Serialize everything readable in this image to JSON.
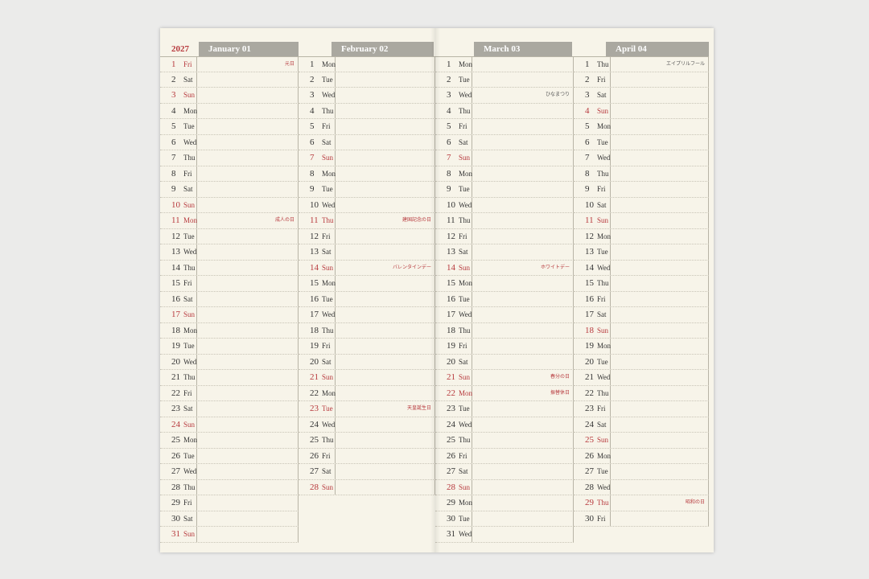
{
  "year": "2027",
  "months": [
    {
      "title": "January 01",
      "days": [
        {
          "d": "1",
          "w": "Fri",
          "red": true,
          "h": "元日"
        },
        {
          "d": "2",
          "w": "Sat"
        },
        {
          "d": "3",
          "w": "Sun",
          "red": true
        },
        {
          "d": "4",
          "w": "Mon"
        },
        {
          "d": "5",
          "w": "Tue"
        },
        {
          "d": "6",
          "w": "Wed"
        },
        {
          "d": "7",
          "w": "Thu"
        },
        {
          "d": "8",
          "w": "Fri"
        },
        {
          "d": "9",
          "w": "Sat"
        },
        {
          "d": "10",
          "w": "Sun",
          "red": true
        },
        {
          "d": "11",
          "w": "Mon",
          "red": true,
          "h": "成人の日"
        },
        {
          "d": "12",
          "w": "Tue"
        },
        {
          "d": "13",
          "w": "Wed"
        },
        {
          "d": "14",
          "w": "Thu"
        },
        {
          "d": "15",
          "w": "Fri"
        },
        {
          "d": "16",
          "w": "Sat"
        },
        {
          "d": "17",
          "w": "Sun",
          "red": true
        },
        {
          "d": "18",
          "w": "Mon"
        },
        {
          "d": "19",
          "w": "Tue"
        },
        {
          "d": "20",
          "w": "Wed"
        },
        {
          "d": "21",
          "w": "Thu"
        },
        {
          "d": "22",
          "w": "Fri"
        },
        {
          "d": "23",
          "w": "Sat"
        },
        {
          "d": "24",
          "w": "Sun",
          "red": true
        },
        {
          "d": "25",
          "w": "Mon"
        },
        {
          "d": "26",
          "w": "Tue"
        },
        {
          "d": "27",
          "w": "Wed"
        },
        {
          "d": "28",
          "w": "Thu"
        },
        {
          "d": "29",
          "w": "Fri"
        },
        {
          "d": "30",
          "w": "Sat"
        },
        {
          "d": "31",
          "w": "Sun",
          "red": true
        }
      ]
    },
    {
      "title": "February 02",
      "days": [
        {
          "d": "1",
          "w": "Mon"
        },
        {
          "d": "2",
          "w": "Tue"
        },
        {
          "d": "3",
          "w": "Wed"
        },
        {
          "d": "4",
          "w": "Thu"
        },
        {
          "d": "5",
          "w": "Fri"
        },
        {
          "d": "6",
          "w": "Sat"
        },
        {
          "d": "7",
          "w": "Sun",
          "red": true
        },
        {
          "d": "8",
          "w": "Mon"
        },
        {
          "d": "9",
          "w": "Tue"
        },
        {
          "d": "10",
          "w": "Wed"
        },
        {
          "d": "11",
          "w": "Thu",
          "red": true,
          "h": "建国記念の日"
        },
        {
          "d": "12",
          "w": "Fri"
        },
        {
          "d": "13",
          "w": "Sat"
        },
        {
          "d": "14",
          "w": "Sun",
          "red": true,
          "h": "バレンタインデー"
        },
        {
          "d": "15",
          "w": "Mon"
        },
        {
          "d": "16",
          "w": "Tue"
        },
        {
          "d": "17",
          "w": "Wed"
        },
        {
          "d": "18",
          "w": "Thu"
        },
        {
          "d": "19",
          "w": "Fri"
        },
        {
          "d": "20",
          "w": "Sat"
        },
        {
          "d": "21",
          "w": "Sun",
          "red": true
        },
        {
          "d": "22",
          "w": "Mon"
        },
        {
          "d": "23",
          "w": "Tue",
          "red": true,
          "h": "天皇誕生日"
        },
        {
          "d": "24",
          "w": "Wed"
        },
        {
          "d": "25",
          "w": "Thu"
        },
        {
          "d": "26",
          "w": "Fri"
        },
        {
          "d": "27",
          "w": "Sat"
        },
        {
          "d": "28",
          "w": "Sun",
          "red": true
        }
      ]
    },
    {
      "title": "March 03",
      "days": [
        {
          "d": "1",
          "w": "Mon"
        },
        {
          "d": "2",
          "w": "Tue"
        },
        {
          "d": "3",
          "w": "Wed",
          "h": "ひなまつり",
          "dark": true
        },
        {
          "d": "4",
          "w": "Thu"
        },
        {
          "d": "5",
          "w": "Fri"
        },
        {
          "d": "6",
          "w": "Sat"
        },
        {
          "d": "7",
          "w": "Sun",
          "red": true
        },
        {
          "d": "8",
          "w": "Mon"
        },
        {
          "d": "9",
          "w": "Tue"
        },
        {
          "d": "10",
          "w": "Wed"
        },
        {
          "d": "11",
          "w": "Thu"
        },
        {
          "d": "12",
          "w": "Fri"
        },
        {
          "d": "13",
          "w": "Sat"
        },
        {
          "d": "14",
          "w": "Sun",
          "red": true,
          "h": "ホワイトデー"
        },
        {
          "d": "15",
          "w": "Mon"
        },
        {
          "d": "16",
          "w": "Tue"
        },
        {
          "d": "17",
          "w": "Wed"
        },
        {
          "d": "18",
          "w": "Thu"
        },
        {
          "d": "19",
          "w": "Fri"
        },
        {
          "d": "20",
          "w": "Sat"
        },
        {
          "d": "21",
          "w": "Sun",
          "red": true,
          "h": "春分の日"
        },
        {
          "d": "22",
          "w": "Mon",
          "red": true,
          "h": "振替休日"
        },
        {
          "d": "23",
          "w": "Tue"
        },
        {
          "d": "24",
          "w": "Wed"
        },
        {
          "d": "25",
          "w": "Thu"
        },
        {
          "d": "26",
          "w": "Fri"
        },
        {
          "d": "27",
          "w": "Sat"
        },
        {
          "d": "28",
          "w": "Sun",
          "red": true
        },
        {
          "d": "29",
          "w": "Mon"
        },
        {
          "d": "30",
          "w": "Tue"
        },
        {
          "d": "31",
          "w": "Wed"
        }
      ]
    },
    {
      "title": "April 04",
      "days": [
        {
          "d": "1",
          "w": "Thu",
          "h": "エイプリルフール",
          "dark": true
        },
        {
          "d": "2",
          "w": "Fri"
        },
        {
          "d": "3",
          "w": "Sat"
        },
        {
          "d": "4",
          "w": "Sun",
          "red": true
        },
        {
          "d": "5",
          "w": "Mon"
        },
        {
          "d": "6",
          "w": "Tue"
        },
        {
          "d": "7",
          "w": "Wed"
        },
        {
          "d": "8",
          "w": "Thu"
        },
        {
          "d": "9",
          "w": "Fri"
        },
        {
          "d": "10",
          "w": "Sat"
        },
        {
          "d": "11",
          "w": "Sun",
          "red": true
        },
        {
          "d": "12",
          "w": "Mon"
        },
        {
          "d": "13",
          "w": "Tue"
        },
        {
          "d": "14",
          "w": "Wed"
        },
        {
          "d": "15",
          "w": "Thu"
        },
        {
          "d": "16",
          "w": "Fri"
        },
        {
          "d": "17",
          "w": "Sat"
        },
        {
          "d": "18",
          "w": "Sun",
          "red": true
        },
        {
          "d": "19",
          "w": "Mon"
        },
        {
          "d": "20",
          "w": "Tue"
        },
        {
          "d": "21",
          "w": "Wed"
        },
        {
          "d": "22",
          "w": "Thu"
        },
        {
          "d": "23",
          "w": "Fri"
        },
        {
          "d": "24",
          "w": "Sat"
        },
        {
          "d": "25",
          "w": "Sun",
          "red": true
        },
        {
          "d": "26",
          "w": "Mon"
        },
        {
          "d": "27",
          "w": "Tue"
        },
        {
          "d": "28",
          "w": "Wed"
        },
        {
          "d": "29",
          "w": "Thu",
          "red": true,
          "h": "昭和の日"
        },
        {
          "d": "30",
          "w": "Fri"
        }
      ]
    }
  ]
}
